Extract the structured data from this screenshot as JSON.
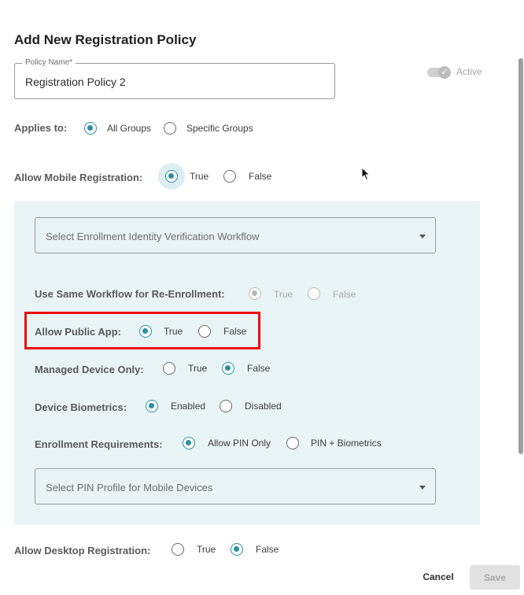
{
  "dialog": {
    "title": "Add New Registration Policy",
    "policy_name": {
      "label": "Policy Name*",
      "value": "Registration Policy 2"
    },
    "active_toggle": {
      "label": "Active",
      "checked": true,
      "disabled": true
    }
  },
  "applies_to": {
    "label": "Applies to:",
    "options": [
      "All Groups",
      "Specific Groups"
    ],
    "selected": "All Groups"
  },
  "mobile_registration": {
    "label": "Allow Mobile Registration:",
    "options": [
      "True",
      "False"
    ],
    "selected": "True",
    "workflow_select": {
      "placeholder": "Select Enrollment Identity Verification Workflow"
    },
    "same_workflow": {
      "label": "Use Same Workflow for Re-Enrollment:",
      "options": [
        "True",
        "False"
      ],
      "selected": "True",
      "disabled": true
    },
    "public_app": {
      "label": "Allow Public App:",
      "options": [
        "True",
        "False"
      ],
      "selected": "True"
    },
    "managed_device": {
      "label": "Managed Device Only:",
      "options": [
        "True",
        "False"
      ],
      "selected": "False"
    },
    "device_biometrics": {
      "label": "Device Biometrics:",
      "options": [
        "Enabled",
        "Disabled"
      ],
      "selected": "Enabled"
    },
    "enrollment_requirements": {
      "label": "Enrollment Requirements:",
      "options": [
        "Allow PIN Only",
        "PIN + Biometrics"
      ],
      "selected": "Allow PIN Only"
    },
    "pin_profile_select": {
      "placeholder": "Select PIN Profile for Mobile Devices"
    }
  },
  "desktop_registration": {
    "label": "Allow Desktop Registration:",
    "options": [
      "True",
      "False"
    ],
    "selected": "False"
  },
  "footer": {
    "cancel_label": "Cancel",
    "save_label": "Save"
  },
  "colors": {
    "accent": "#2d8fa3",
    "panel_bg": "#e8f4f6",
    "highlight": "#ee0c0c"
  }
}
